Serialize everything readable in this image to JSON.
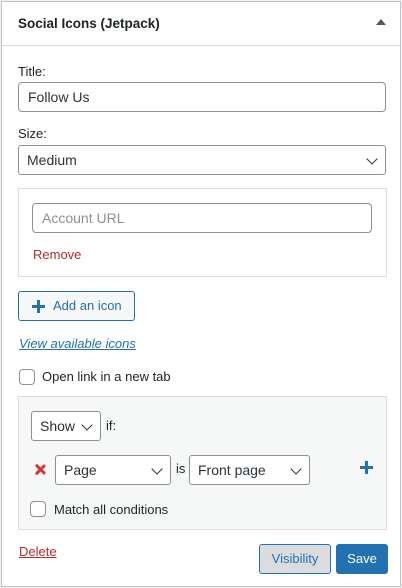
{
  "widget": {
    "title": "Social Icons (Jetpack)",
    "title_label": "Title:",
    "title_value": "Follow Us",
    "size_label": "Size:",
    "size_value": "Medium",
    "account_url_placeholder": "Account URL",
    "remove_label": "Remove",
    "add_icon_label": "Add an icon",
    "view_icons_label": "View available icons",
    "new_tab_label": "Open link in a new tab",
    "new_tab_checked": false
  },
  "visibility": {
    "action_value": "Show",
    "if_label": "if:",
    "rule": {
      "major_value": "Page",
      "is_label": "is",
      "minor_value": "Front page"
    },
    "match_all_label": "Match all conditions",
    "match_all_checked": false
  },
  "footer": {
    "delete_label": "Delete",
    "visibility_button_label": "Visibility",
    "save_button_label": "Save"
  },
  "colors": {
    "accent": "#2271b1",
    "danger": "#b32d2e",
    "remove_x": "#d63638"
  }
}
